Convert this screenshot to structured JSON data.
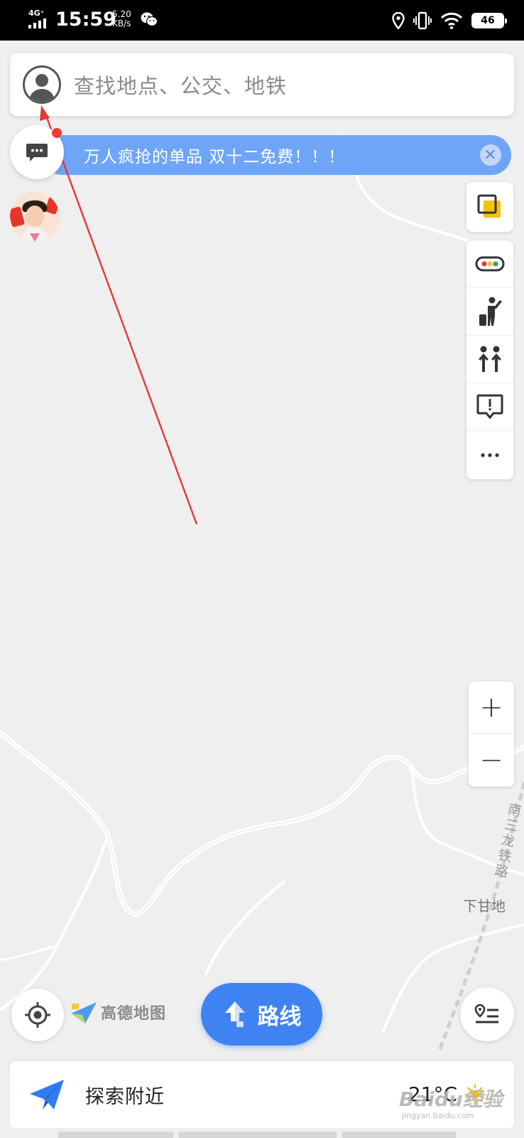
{
  "status_bar": {
    "network": "4G⁺",
    "time": "15:59",
    "speed_value": "5.20",
    "speed_unit": "KB/s",
    "battery": "46"
  },
  "search": {
    "placeholder": "查找地点、公交、地铁"
  },
  "banner": {
    "text": "万人疯抢的单品 双十二免费！！！",
    "close_glyph": "✕"
  },
  "map": {
    "place_label": "下甘地",
    "railway_label": "南三龙铁路"
  },
  "zoom": {
    "in_glyph": "+",
    "out_glyph": "−"
  },
  "brand": {
    "logo_text": "高德地图"
  },
  "route_button": {
    "label": "路线"
  },
  "explore_bar": {
    "label": "探索附近",
    "temperature": "21°C"
  },
  "watermark": {
    "text": "Baidu经验",
    "sub": "jingyan.baidu.com"
  },
  "colors": {
    "primary_blue": "#3f83f3",
    "banner_blue": "#6fa5f7",
    "annotation_red": "#e53935"
  }
}
